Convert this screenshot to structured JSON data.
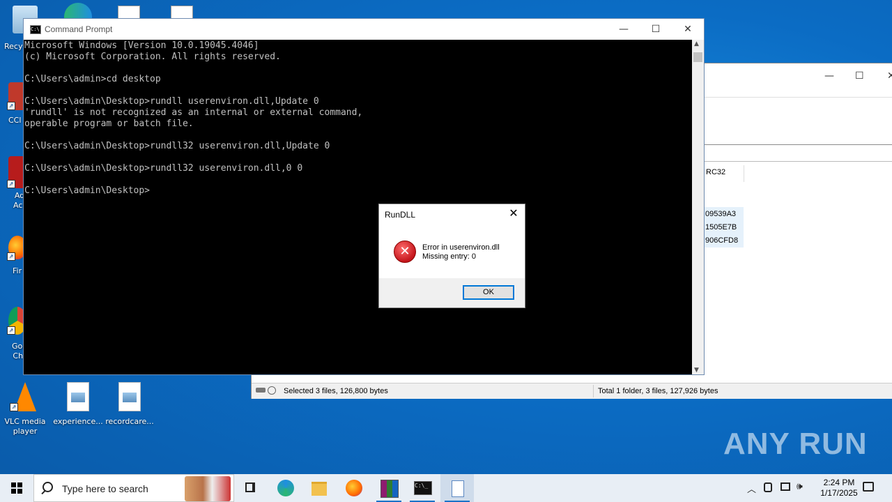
{
  "desktop": {
    "icons": [
      {
        "label": "Recy",
        "name": "recycle-bin"
      },
      {
        "label": "CCl",
        "name": "ccleaner"
      },
      {
        "label": "Ad Acr",
        "name": "adobe-acrobat"
      },
      {
        "label": "Fir",
        "name": "firefox"
      },
      {
        "label": "Goo Chr",
        "name": "google-chrome"
      },
      {
        "label": "VLC media player",
        "name": "vlc"
      },
      {
        "label": "experience...",
        "name": "experience-file"
      },
      {
        "label": "recordcare...",
        "name": "recordcare-file"
      }
    ]
  },
  "explorer": {
    "column_header": "RC32",
    "rows": [
      "09539A3",
      "1505E7B",
      "906CFD8"
    ],
    "status_left": "Selected 3 files, 126,800 bytes",
    "status_right": "Total 1 folder, 3 files, 127,926 bytes"
  },
  "cmd": {
    "title": "Command Prompt",
    "lines": [
      "Microsoft Windows [Version 10.0.19045.4046]",
      "(c) Microsoft Corporation. All rights reserved.",
      "",
      "C:\\Users\\admin>cd desktop",
      "",
      "C:\\Users\\admin\\Desktop>rundll userenviron.dll,Update 0",
      "'rundll' is not recognized as an internal or external command,",
      "operable program or batch file.",
      "",
      "C:\\Users\\admin\\Desktop>rundll32 userenviron.dll,Update 0",
      "",
      "C:\\Users\\admin\\Desktop>rundll32 userenviron.dll,0 0",
      "",
      "C:\\Users\\admin\\Desktop>"
    ]
  },
  "dialog": {
    "title": "RunDLL",
    "message_line1": "Error in userenviron.dll",
    "message_line2": "Missing entry: 0",
    "ok_label": "OK"
  },
  "taskbar": {
    "search_placeholder": "Type here to search",
    "time": "2:24 PM",
    "date": "1/17/2025"
  },
  "watermark": "ANY RUN"
}
